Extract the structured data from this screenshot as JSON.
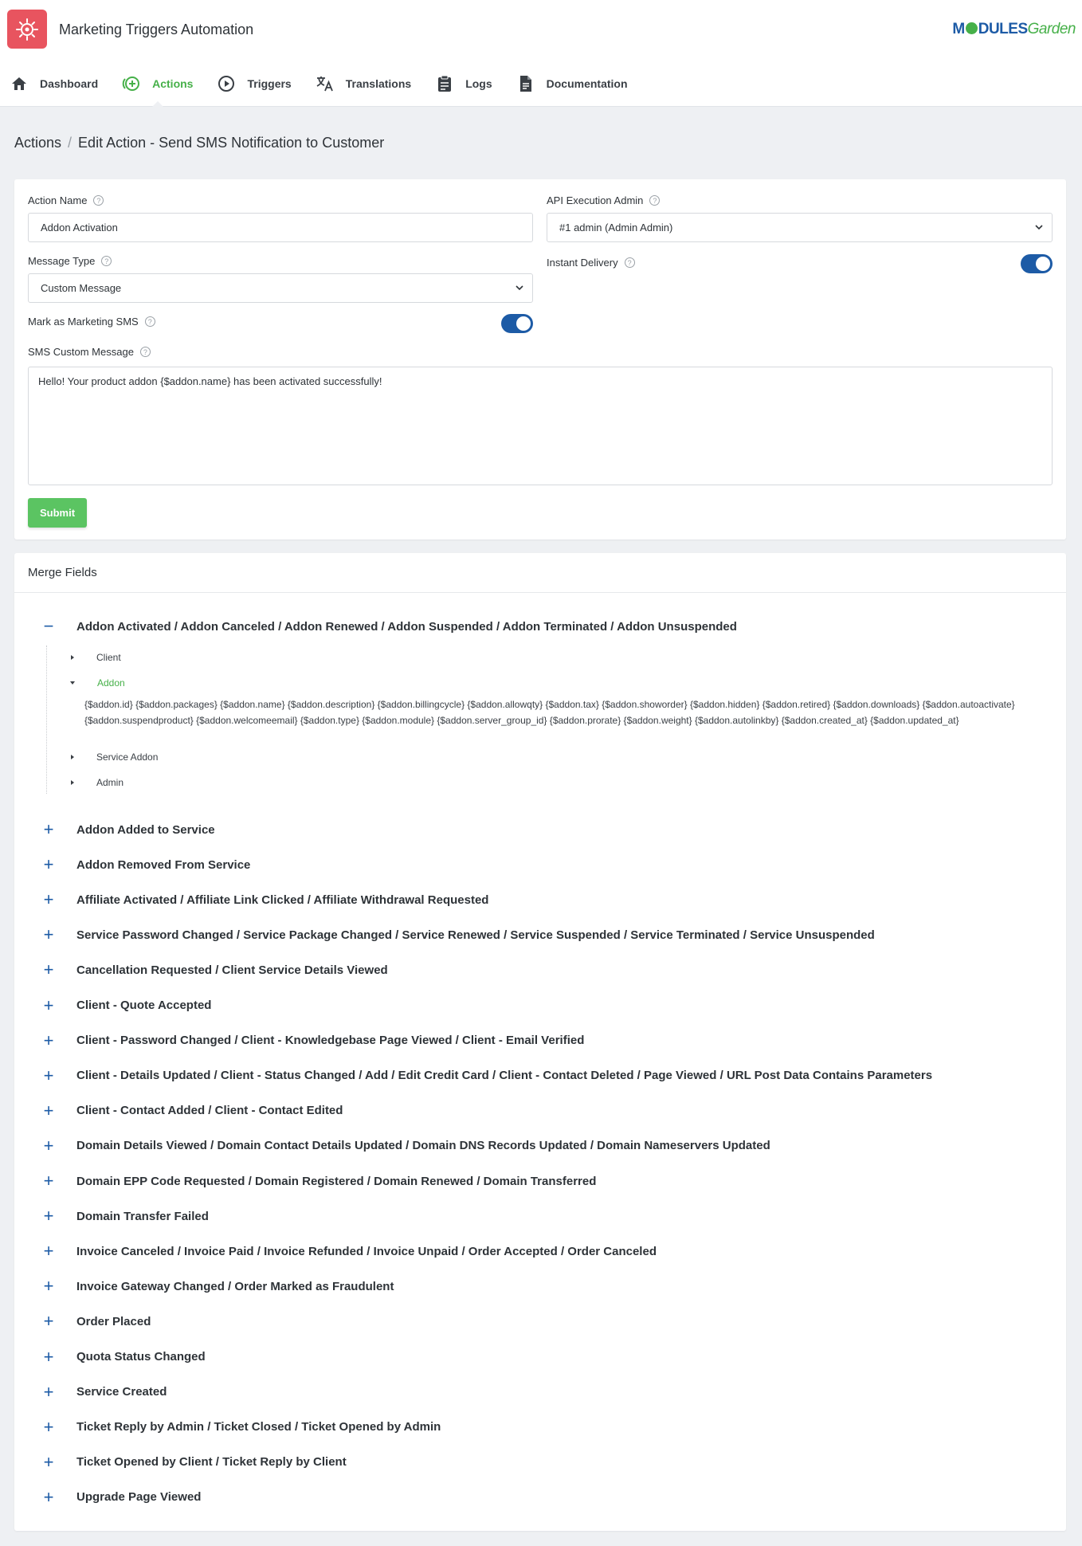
{
  "app": {
    "title": "Marketing Triggers Automation",
    "brand_prefix": "M",
    "brand_mid": "DULES",
    "brand_suffix": "Garden",
    "accent": "#46b049",
    "primary": "#1d5ba6",
    "logo_color": "#e8545f"
  },
  "nav": [
    {
      "label": "Dashboard",
      "icon": "home-icon"
    },
    {
      "label": "Actions",
      "icon": "plus-circle-icon",
      "active": true
    },
    {
      "label": "Triggers",
      "icon": "play-circle-icon"
    },
    {
      "label": "Translations",
      "icon": "translate-icon"
    },
    {
      "label": "Logs",
      "icon": "clipboard-icon"
    },
    {
      "label": "Documentation",
      "icon": "document-icon"
    }
  ],
  "breadcrumb": {
    "root": "Actions",
    "separator": "/",
    "current": "Edit Action - Send SMS Notification to Customer"
  },
  "form": {
    "action_name": {
      "label": "Action Name",
      "value": "Addon Activation"
    },
    "api_admin": {
      "label": "API Execution Admin",
      "value": "#1 admin (Admin Admin)"
    },
    "message_type": {
      "label": "Message Type",
      "value": "Custom Message"
    },
    "instant_delivery": {
      "label": "Instant Delivery",
      "on": true
    },
    "marketing_sms": {
      "label": "Mark as Marketing SMS",
      "on": true
    },
    "custom_message": {
      "label": "SMS Custom Message",
      "value": "Hello! Your product addon {$addon.name} has been activated successfully!"
    },
    "submit_label": "Submit",
    "help_glyph": "?"
  },
  "merge_fields": {
    "title": "Merge Fields",
    "expanded_group": "Addon Activated / Addon Canceled / Addon Renewed / Addon Suspended / Addon Terminated / Addon Unsuspended",
    "collapse_glyph": "−",
    "expand_glyph": "+",
    "tree": [
      {
        "label": "Client"
      },
      {
        "label": "Addon",
        "open": true
      },
      {
        "label": "Service Addon"
      },
      {
        "label": "Admin"
      }
    ],
    "addon_fields": "{$addon.id} {$addon.packages} {$addon.name} {$addon.description} {$addon.billingcycle} {$addon.allowqty} {$addon.tax} {$addon.showorder} {$addon.hidden} {$addon.retired} {$addon.downloads} {$addon.autoactivate} {$addon.suspendproduct} {$addon.welcomeemail} {$addon.type} {$addon.module} {$addon.server_group_id} {$addon.prorate} {$addon.weight} {$addon.autolinkby} {$addon.created_at} {$addon.updated_at}",
    "groups": [
      "Addon Added to Service",
      "Addon Removed From Service",
      "Affiliate Activated / Affiliate Link Clicked / Affiliate Withdrawal Requested",
      "Service Password Changed / Service Package Changed / Service Renewed / Service Suspended / Service Terminated / Service Unsuspended",
      "Cancellation Requested / Client Service Details Viewed",
      "Client - Quote Accepted",
      "Client - Password Changed / Client - Knowledgebase Page Viewed / Client - Email Verified",
      "Client - Details Updated / Client - Status Changed / Add / Edit Credit Card / Client - Contact Deleted / Page Viewed / URL Post Data Contains Parameters",
      "Client - Contact Added / Client - Contact Edited",
      "Domain Details Viewed / Domain Contact Details Updated / Domain DNS Records Updated / Domain Nameservers Updated",
      "Domain EPP Code Requested / Domain Registered / Domain Renewed / Domain Transferred",
      "Domain Transfer Failed",
      "Invoice Canceled / Invoice Paid / Invoice Refunded / Invoice Unpaid / Order Accepted / Order Canceled",
      "Invoice Gateway Changed / Order Marked as Fraudulent",
      "Order Placed",
      "Quota Status Changed",
      "Service Created",
      "Ticket Reply by Admin / Ticket Closed / Ticket Opened by Admin",
      "Ticket Opened by Client / Ticket Reply by Client",
      "Upgrade Page Viewed"
    ]
  }
}
